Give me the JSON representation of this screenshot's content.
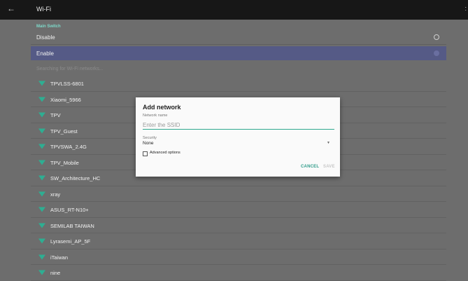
{
  "topbar": {
    "title": "Wi-Fi",
    "back_icon": "back-arrow-icon"
  },
  "main_switch": {
    "label": "Main Switch",
    "options": [
      {
        "label": "Disable",
        "selected": false
      },
      {
        "label": "Enable",
        "selected": true
      }
    ]
  },
  "status_text": "Searching for Wi-Fi networks...",
  "networks": [
    {
      "name": "TPVLSS-6801",
      "icon": "wifi-signal-icon"
    },
    {
      "name": "Xiaomi_5966",
      "icon": "wifi-signal-icon"
    },
    {
      "name": "TPV",
      "icon": "wifi-signal-icon"
    },
    {
      "name": "TPV_Guest",
      "icon": "wifi-signal-icon"
    },
    {
      "name": "TPVSWA_2.4G",
      "icon": "wifi-signal-icon"
    },
    {
      "name": "TPV_Mobile",
      "icon": "wifi-signal-icon"
    },
    {
      "name": "SW_Architecture_HC",
      "icon": "wifi-signal-icon"
    },
    {
      "name": "xray",
      "icon": "wifi-signal-icon"
    },
    {
      "name": "ASUS_RT-N10+",
      "icon": "wifi-signal-icon"
    },
    {
      "name": "SEMILAB TAIWAN",
      "icon": "wifi-signal-icon"
    },
    {
      "name": "Lyrasemi_AP_5F",
      "icon": "wifi-signal-icon"
    },
    {
      "name": "iTaiwan",
      "icon": "wifi-signal-icon"
    },
    {
      "name": "nine",
      "icon": "wifi-signal-icon"
    }
  ],
  "dialog": {
    "title": "Add network",
    "network_name_label": "Network name",
    "ssid_placeholder": "Enter the SSID",
    "ssid_value": "",
    "security_label": "Security",
    "security_value": "None",
    "advanced_label": "Advanced options",
    "advanced_checked": false,
    "cancel_label": "CANCEL",
    "save_label": "SAVE"
  },
  "colors": {
    "accent": "#2f9c8a",
    "highlight_row": "#555a86",
    "topbar": "#171717",
    "background": "#6d6d6d"
  }
}
